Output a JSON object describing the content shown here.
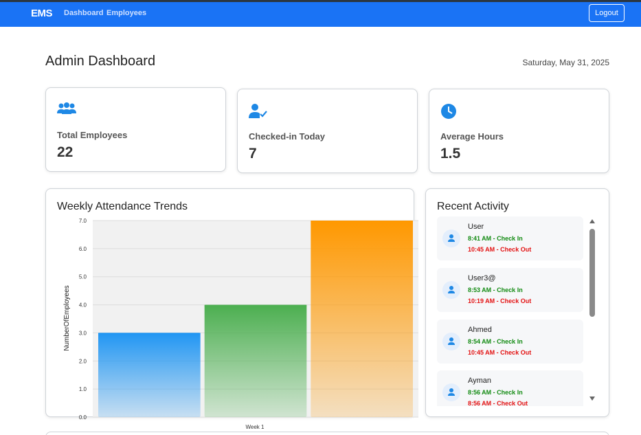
{
  "navbar": {
    "brand": "EMS",
    "links": [
      "Dashboard",
      "Employees"
    ],
    "logout_label": "Logout"
  },
  "header": {
    "title": "Admin Dashboard",
    "date": "Saturday, May 31, 2025"
  },
  "stats": [
    {
      "icon": "users-group-icon",
      "label": "Total Employees",
      "value": "22"
    },
    {
      "icon": "user-check-icon",
      "label": "Checked-in Today",
      "value": "7"
    },
    {
      "icon": "clock-icon",
      "label": "Average Hours",
      "value": "1.5"
    }
  ],
  "chart_panel": {
    "title": "Weekly Attendance Trends"
  },
  "chart_data": {
    "type": "bar",
    "categories": [
      "Week 1"
    ],
    "series": [
      {
        "values": [
          3
        ],
        "color": "#2196f3"
      },
      {
        "values": [
          4
        ],
        "color": "#4caf50"
      },
      {
        "values": [
          7
        ],
        "color": "#ff9800"
      }
    ],
    "ylabel": "NumberOfEmployees",
    "xlabel": "",
    "ylim": [
      0,
      7
    ],
    "yticks": [
      "0.0",
      "1.0",
      "2.0",
      "3.0",
      "4.0",
      "5.0",
      "6.0",
      "7.0"
    ],
    "grid": true
  },
  "activity": {
    "title": "Recent Activity",
    "items": [
      {
        "name": "User",
        "check_in": "8:41 AM - Check In",
        "check_out": "10:45 AM - Check Out"
      },
      {
        "name": "User3@",
        "check_in": "8:53 AM - Check In",
        "check_out": "10:19 AM - Check Out"
      },
      {
        "name": "Ahmed",
        "check_in": "8:54 AM - Check In",
        "check_out": "10:45 AM - Check Out"
      },
      {
        "name": "Ayman",
        "check_in": "8:56 AM - Check In",
        "check_out": "8:56 AM - Check Out"
      }
    ]
  },
  "colors": {
    "navbar": "#1a73f5",
    "accent": "#1e88e5",
    "check_in": "#118a11",
    "check_out": "#e31111"
  }
}
